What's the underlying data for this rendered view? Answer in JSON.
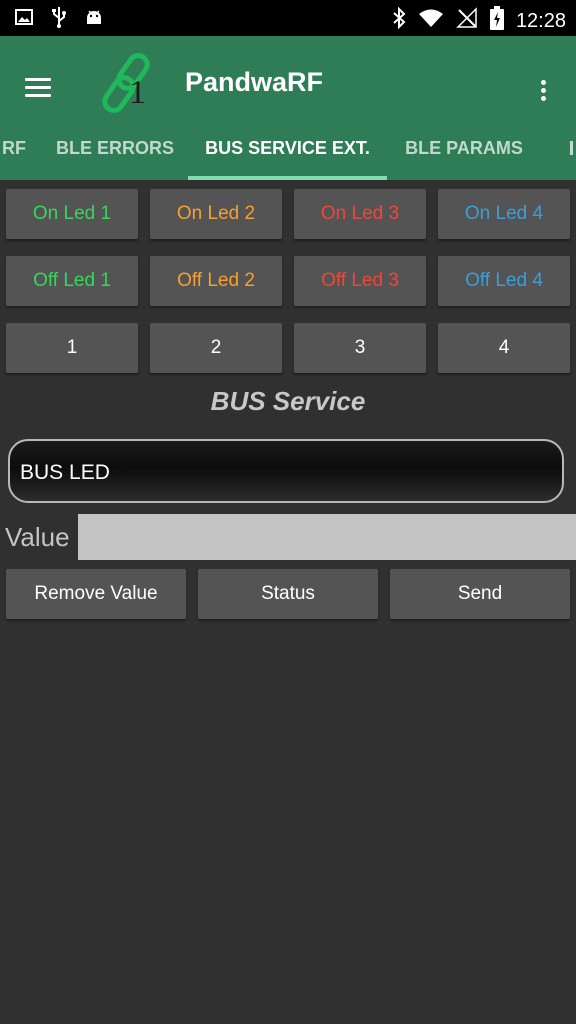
{
  "status_bar": {
    "time": "12:28",
    "left_icons": [
      "image-icon",
      "usb-icon",
      "android-icon"
    ],
    "right_icons": [
      "bluetooth-icon",
      "wifi-icon",
      "no-signal-icon",
      "battery-charging-icon"
    ]
  },
  "app_bar": {
    "title": "PandwaRF",
    "logo_digit": "1",
    "colors": {
      "background": "#2e7d57",
      "indicator": "#7ee0b0"
    }
  },
  "tabs": [
    {
      "label": "RF"
    },
    {
      "label": "BLE ERRORS"
    },
    {
      "label": "BUS SERVICE EXT.",
      "active": true
    },
    {
      "label": "BLE PARAMS"
    }
  ],
  "led_buttons": {
    "on": [
      {
        "label": "On Led 1",
        "color": "#34d85a"
      },
      {
        "label": "On Led 2",
        "color": "#f5a030"
      },
      {
        "label": "On Led 3",
        "color": "#f0463a"
      },
      {
        "label": "On Led 4",
        "color": "#3a9fd8"
      }
    ],
    "off": [
      {
        "label": "Off Led 1",
        "color": "#34d85a"
      },
      {
        "label": "Off Led 2",
        "color": "#f5a030"
      },
      {
        "label": "Off Led 3",
        "color": "#f0463a"
      },
      {
        "label": "Off Led 4",
        "color": "#3a9fd8"
      }
    ],
    "numbers": [
      "1",
      "2",
      "3",
      "4"
    ]
  },
  "bus_service": {
    "heading": "BUS Service",
    "selected": "BUS LED",
    "value_label": "Value",
    "value_placeholder": "",
    "value": ""
  },
  "actions": {
    "remove": "Remove Value",
    "status": "Status",
    "send": "Send"
  }
}
